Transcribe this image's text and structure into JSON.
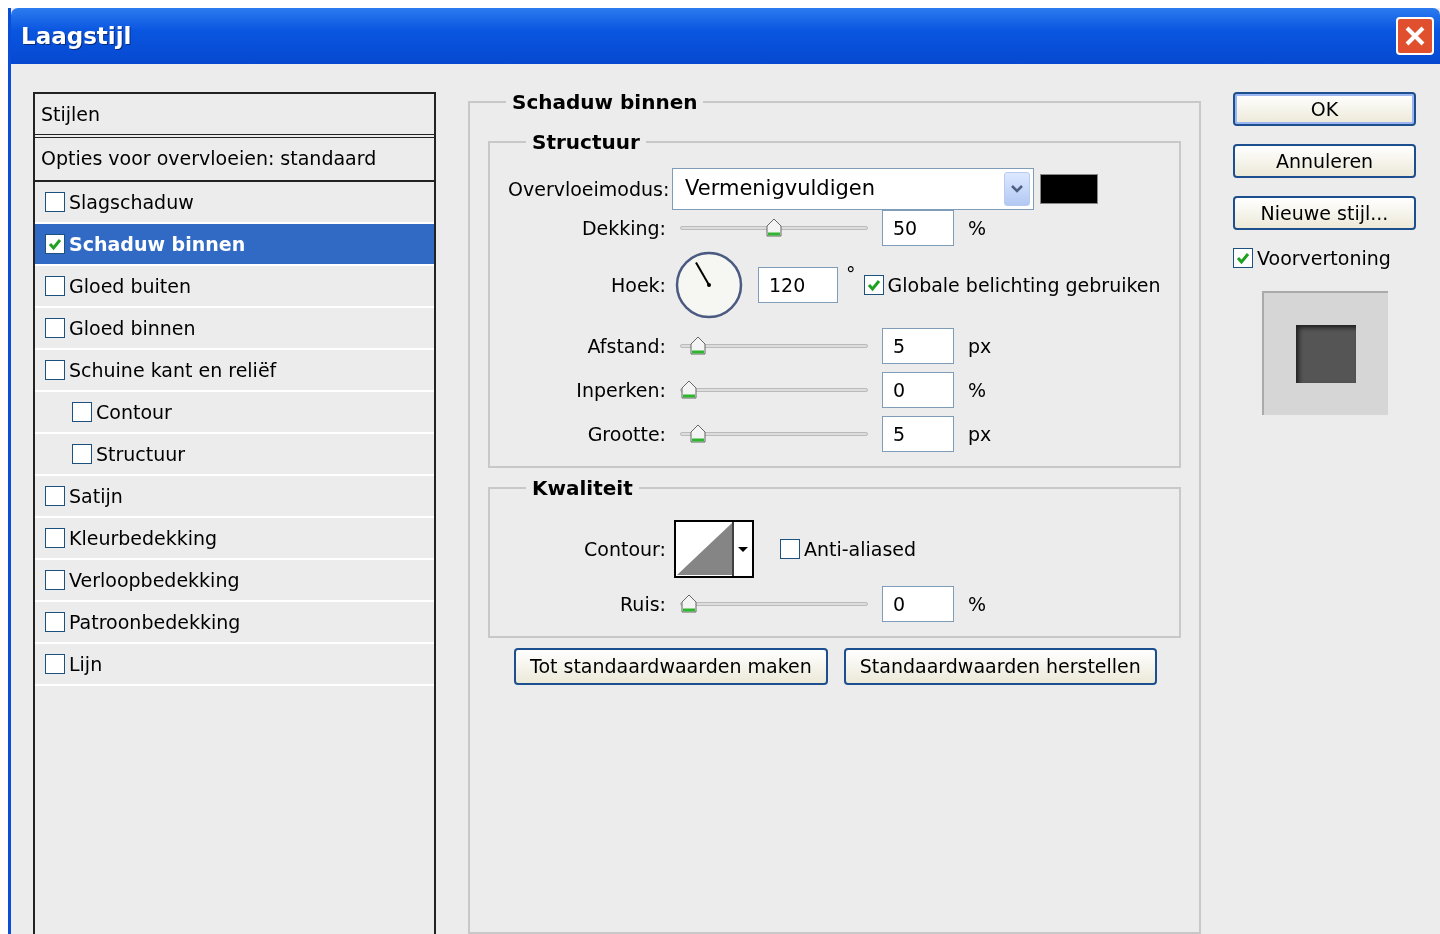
{
  "window": {
    "title": "Laagstijl"
  },
  "styles_panel": {
    "header": "Stijlen",
    "blend_options": "Opties voor overvloeien: standaard",
    "items": [
      {
        "label": "Slagschaduw",
        "checked": false,
        "selected": false
      },
      {
        "label": "Schaduw binnen",
        "checked": true,
        "selected": true
      },
      {
        "label": "Gloed buiten",
        "checked": false,
        "selected": false
      },
      {
        "label": "Gloed binnen",
        "checked": false,
        "selected": false
      },
      {
        "label": "Schuine kant en reliëf",
        "checked": false,
        "selected": false,
        "children": [
          {
            "label": "Contour",
            "checked": false,
            "selected": false
          },
          {
            "label": "Structuur",
            "checked": false,
            "selected": false
          }
        ]
      },
      {
        "label": "Satijn",
        "checked": false,
        "selected": false
      },
      {
        "label": "Kleurbedekking",
        "checked": false,
        "selected": false
      },
      {
        "label": "Verloopbedekking",
        "checked": false,
        "selected": false
      },
      {
        "label": "Patroonbedekking",
        "checked": false,
        "selected": false
      },
      {
        "label": "Lijn",
        "checked": false,
        "selected": false
      }
    ]
  },
  "effect": {
    "title": "Schaduw binnen",
    "structure": {
      "title": "Structuur",
      "blend_mode": {
        "label": "Overvloeimodus:",
        "value": "Vermenigvuldigen",
        "color": "#000000"
      },
      "rows": [
        {
          "kind": "slider",
          "label": "Dekking:",
          "level": 0.5,
          "value": "50",
          "unit": "%"
        },
        {
          "kind": "angle",
          "label": "Hoek:",
          "value": "120",
          "unit": "°",
          "global_light": {
            "label": "Globale belichting gebruiken",
            "checked": true
          }
        },
        {
          "kind": "slider",
          "label": "Afstand:",
          "level": 0.05,
          "value": "5",
          "unit": "px"
        },
        {
          "kind": "slider",
          "label": "Inperken:",
          "level": 0,
          "value": "0",
          "unit": "%"
        },
        {
          "kind": "slider",
          "label": "Grootte:",
          "level": 0.05,
          "value": "5",
          "unit": "px"
        }
      ]
    },
    "quality": {
      "title": "Kwaliteit",
      "contour_label": "Contour:",
      "anti_aliased": {
        "label": "Anti-aliased",
        "checked": false
      },
      "noise": {
        "label": "Ruis:",
        "level": 0,
        "value": "0",
        "unit": "%"
      }
    },
    "buttons": [
      "Tot standaardwaarden maken",
      "Standaardwaarden herstellen"
    ]
  },
  "actions": {
    "buttons": [
      {
        "label": "OK",
        "default": true
      },
      {
        "label": "Annuleren",
        "default": false
      },
      {
        "label": "Nieuwe stijl...",
        "default": false
      }
    ],
    "preview": {
      "label": "Voorvertoning",
      "checked": true
    }
  }
}
